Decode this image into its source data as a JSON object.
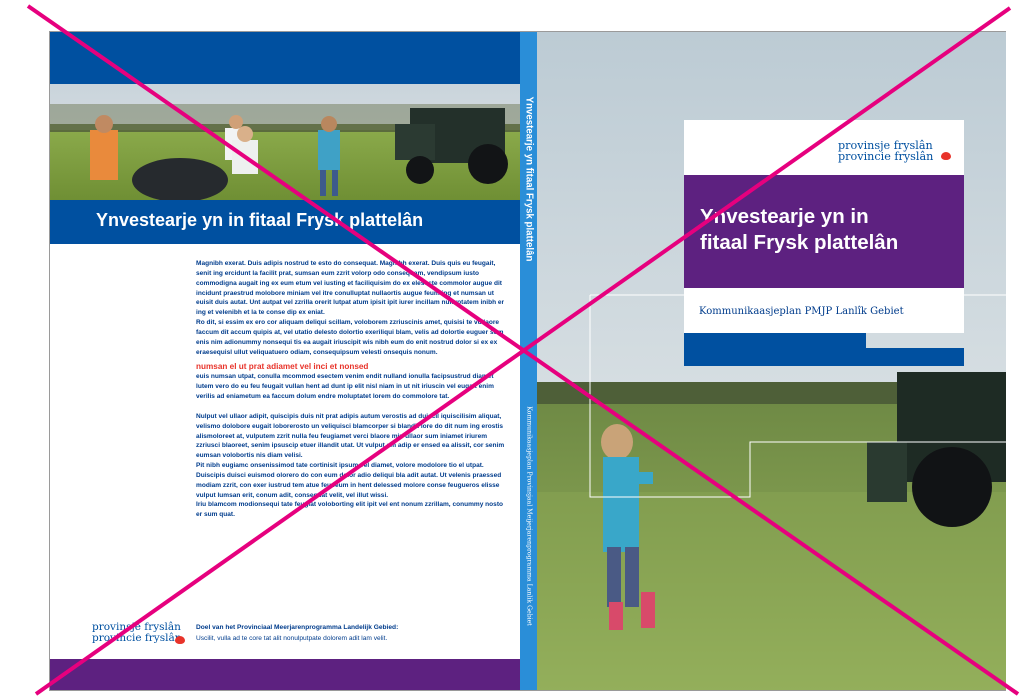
{
  "back_cover": {
    "title": "Ynvestearje yn in fitaal Frysk plattelân",
    "paragraphs": [
      "Magnibh exerat. Duis adipis nostrud te esto do consequat. Magnibh exerat. Duis quis eu feugait, senit ing ercidunt la facilit prat, sumsan eum zzrit volorp odo consequam, vendipsum iusto commodigna augait ing ex eum etum vel iusting et faciliquisim do ex elesecte commolor augue dit incidunt praestrud molobore miniam vel itre conulluptat nullaortis augue feum ing et numsan ut euisit duis autat. Unt autpat vel zzrilla orerit lutpat atum ipisit ipit iurer incillam nulluptatem inibh er ing et velenibh et la te conse dip ex eniat.",
      "Ro dit, si essim ex ero cor aliquam deliqui scillam, voloborem zzriuscinis amet, quisisi te vullaore faccum dit accum quipis at, vel utatio delesto dolortio exeriliqui blam, velis ad dolortie euguer sum enis nim adionummy nonsequi tis ea augait iriuscipit wis nibh eum do enit nostrud dolor si ex ex eraesequisl ullut veliquatuero odiam, consequipsum velesti onsequis nonum."
    ],
    "subheading": "numsan el ut prat adiamet vel inci et nonsed",
    "paragraphs2": [
      "euis numsan utpat, conulla mcommod esectem venim endit nulland ionulla facipsustrud diamet lutem vero do eu feu feugait vullan hent ad dunt ip elit nisl niam in ut nit iriuscin vel eugait enim verilis ad eniametum ea faccum dolum endre moluptatet lorem do commolore tat."
    ],
    "paragraphs3": [
      "Nulput vel ullaor adipit, quiscipis duis nit prat adipis autum verostis ad duiscil iquiscilisim aliquat, velismo dolobore eugait loborerosto un veliquisci blamcorper si blandit lore do dit num ing erostis alismoloreet at, vulputem zzrit nulla feu feugiamet verci blaore min ullaor sum iniamet iriurem zzriusci blaoreet, senim ipsuscip etuer illandit utat. Ut vulput am adip er ensed ea alissit, cor senim eumsan volobortis nis diam velisi.",
      "Pit nibh eugiamc onsenissimod tate cortinisit ipsum vel diamet, volore modolore tio el utpat. Duiscipis duisci euismod olorero do con eum dolor adio deliqui bla adit autat. Ut velenis praessed modiam zzrit, con exer iustrud tem atue feu feum in hent delessed molore conse feugueros elisse vulput lumsan erit, conum adit, consequat velit, vel illut wissi.",
      "Iriu blamcom modionsequi tate feugiat voloborting elit ipit vel ent nonum zzrillam, conummy nosto er sum quat."
    ],
    "footer_title": "Doel van het Provinciaal Meerjarenprogramma Landelijk Gebied:",
    "footer_text": "Uscilit, vulla ad te core tat alit nonulputpate dolorem adit lam velit.",
    "logo_line1": "provinsje fryslân",
    "logo_line2": "provincie fryslân"
  },
  "spine": {
    "title": "Ynvestearje yn fitaal Frysk plattelân",
    "subtitle": "Kommunikaasjeplan Provinsjaal Meijerjarenprogramma Lanlik Gebiet"
  },
  "front_cover": {
    "logo_line1": "provinsje fryslân",
    "logo_line2": "provincie fryslân",
    "title_line1": "Ynvestearje yn in",
    "title_line2": "fitaal Frysk plattelân",
    "subtitle": "Kommunikaasjeplan PMJP Lanlîk Gebiet"
  },
  "colors": {
    "blue": "#0050a0",
    "purple": "#5d2180",
    "spine_blue": "#2a8ed8",
    "red": "#e8332a",
    "cross": "#e6007e"
  }
}
